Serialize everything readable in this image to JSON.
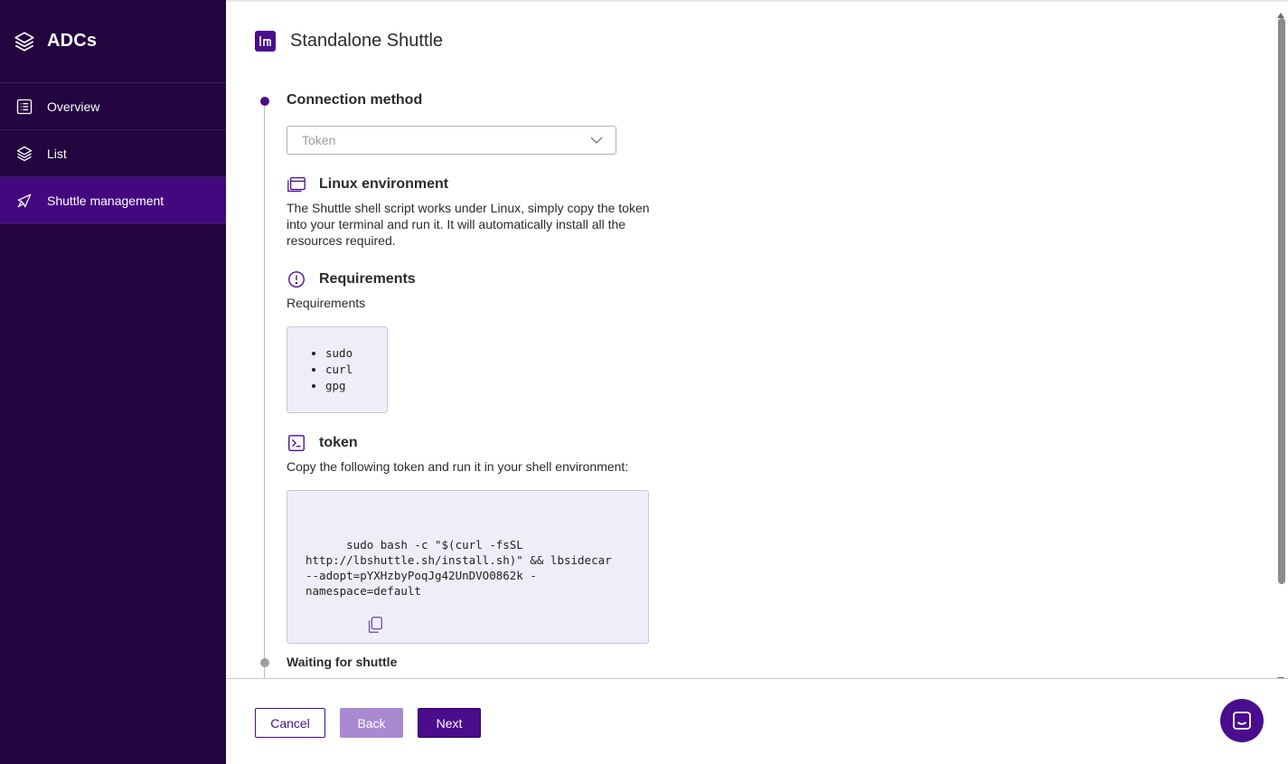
{
  "sidebar": {
    "brand": "ADCs",
    "items": [
      {
        "label": "Overview",
        "icon": "list-icon",
        "active": false
      },
      {
        "label": "List",
        "icon": "layers-icon",
        "active": false
      },
      {
        "label": "Shuttle management",
        "icon": "rocket-icon",
        "active": true
      }
    ]
  },
  "header": {
    "title": "Standalone Shuttle"
  },
  "steps": {
    "connection": {
      "title": "Connection method",
      "select_value": "Token"
    },
    "waiting": {
      "title": "Waiting for shuttle"
    }
  },
  "linux": {
    "title": "Linux environment",
    "description": "The Shuttle shell script works under Linux, simply copy the token into your terminal and run it. It will automatically install all the resources required."
  },
  "requirements": {
    "title": "Requirements",
    "subtitle": "Requirements",
    "items": [
      "sudo",
      "curl",
      "gpg"
    ]
  },
  "token": {
    "title": "token",
    "description": "Copy the following token and run it in your shell environment:",
    "command": "sudo bash -c \"$(curl -fsSL\nhttp://lbshuttle.sh/install.sh)\" && lbsidecar\n--adopt=pYXHzbyPoqJg42UnDVO0862k -\nnamespace=default"
  },
  "footer": {
    "cancel_label": "Cancel",
    "back_label": "Back",
    "next_label": "Next"
  },
  "colors": {
    "sidebar_bg": "#23053f",
    "sidebar_active": "#43087e",
    "accent": "#4a0d8c",
    "accent_light": "#a98ad1",
    "code_bg": "#efeef8"
  }
}
